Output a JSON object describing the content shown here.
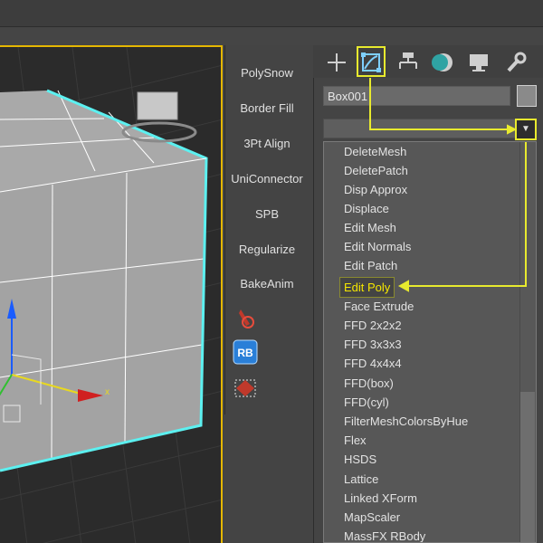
{
  "tool_panel": {
    "buttons": [
      "PolySnow",
      "Border Fill",
      "3Pt Align",
      "UniConnector",
      "SPB",
      "Regularize",
      "BakeAnim"
    ],
    "rb_label": "RB"
  },
  "command_panel": {
    "tabs": [
      "create-icon",
      "modify-icon",
      "hierarchy-icon",
      "motion-icon",
      "display-icon",
      "utilities-icon"
    ],
    "object_name": "Box001",
    "dropdown_arrow_glyph": "▼"
  },
  "modifier_list": {
    "items": [
      "DeleteMesh",
      "DeletePatch",
      "Disp Approx",
      "Displace",
      "Edit Mesh",
      "Edit Normals",
      "Edit Patch",
      "Edit Poly",
      "Face Extrude",
      "FFD 2x2x2",
      "FFD 3x3x3",
      "FFD 4x4x4",
      "FFD(box)",
      "FFD(cyl)",
      "FilterMeshColorsByHue",
      "Flex",
      "HSDS",
      "Lattice",
      "Linked XForm",
      "MapScaler",
      "MassFX RBody"
    ],
    "selected_index": 7
  },
  "viewport": {
    "gizmo_x_label": "x",
    "highlight_color": "#e8ea2e",
    "selection_color": "#5cf0f0"
  }
}
